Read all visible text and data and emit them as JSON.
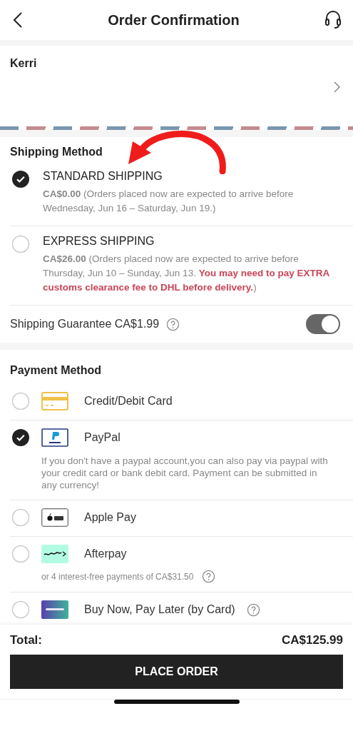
{
  "header": {
    "title": "Order Confirmation"
  },
  "address": {
    "name": "Kerri"
  },
  "shipping": {
    "title": "Shipping Method",
    "options": [
      {
        "name": "STANDARD SHIPPING",
        "selected": true,
        "price": "CA$0.00",
        "note": "(Orders placed now are expected to arrive before Wednesday, Jun 16 – Saturday, Jun 19.)"
      },
      {
        "name": "EXPRESS SHIPPING",
        "selected": false,
        "price": "CA$26.00",
        "note": "(Orders placed now are expected to arrive before Thursday, Jun 10 – Sunday, Jun 13.",
        "warning": "You may need to pay EXTRA customs clearance fee to DHL before delivery.",
        "note_end": ")"
      }
    ],
    "guarantee": {
      "label": "Shipping Guarantee CA$1.99",
      "on": true
    }
  },
  "payment": {
    "title": "Payment Method",
    "methods": [
      {
        "name": "Credit/Debit Card",
        "kind": "card",
        "selected": false
      },
      {
        "name": "PayPal",
        "kind": "paypal",
        "selected": true,
        "note": "If you don't have a paypal account,you can also pay via paypal with your credit card or bank debit card. Payment can be submitted in any currency!"
      },
      {
        "name": "Apple Pay",
        "kind": "applepay",
        "selected": false
      },
      {
        "name": "Afterpay",
        "kind": "afterpay",
        "selected": false,
        "note": "or 4 interest-free payments of CA$31.50",
        "note_help": true
      },
      {
        "name": "Buy Now, Pay Later (by Card)",
        "kind": "paybright",
        "selected": false,
        "help": true
      }
    ]
  },
  "footer": {
    "total_label": "Total:",
    "total": "CA$125.99",
    "button": "PLACE ORDER"
  }
}
